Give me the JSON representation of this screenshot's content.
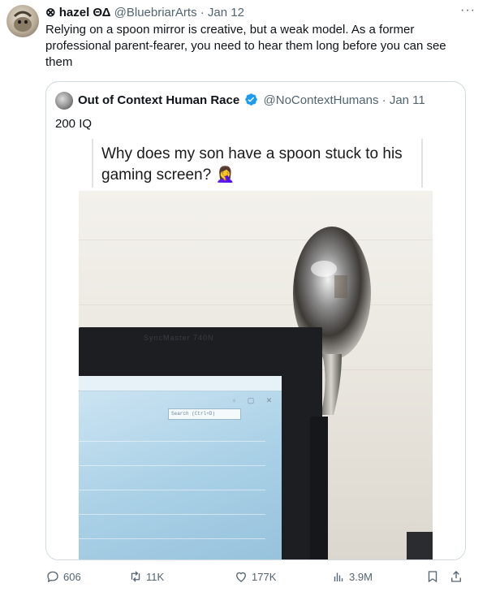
{
  "tweet": {
    "display_name": "⊗ hazel ΘΔ",
    "handle": "@BluebriarArts",
    "separator": " · ",
    "date": "Jan 12",
    "more_icon": "···",
    "text": "Relying on a spoon mirror is creative, but a weak model. As a former professional parent-fearer, you need to hear them long before you can see them"
  },
  "quote": {
    "display_name": "Out of Context Human Race",
    "verified_icon": "verified-badge-icon",
    "handle": "@NoContextHumans",
    "separator": " · ",
    "date": "Jan 11",
    "text": "200 IQ",
    "media": {
      "caption": "Why does my son have a spoon stuck to his gaming screen? 🤦‍♀️",
      "monitor_label": "SyncMaster 740N",
      "screen_search": "Search (Ctrl+D)",
      "screen_window_buttons": "▫ ▢ ✕"
    }
  },
  "actions": {
    "replies": "606",
    "retweets": "11K",
    "likes": "177K",
    "views": "3.9M"
  },
  "colors": {
    "muted": "#536471",
    "verified": "#1d9bf0",
    "border": "#cfd9de"
  }
}
